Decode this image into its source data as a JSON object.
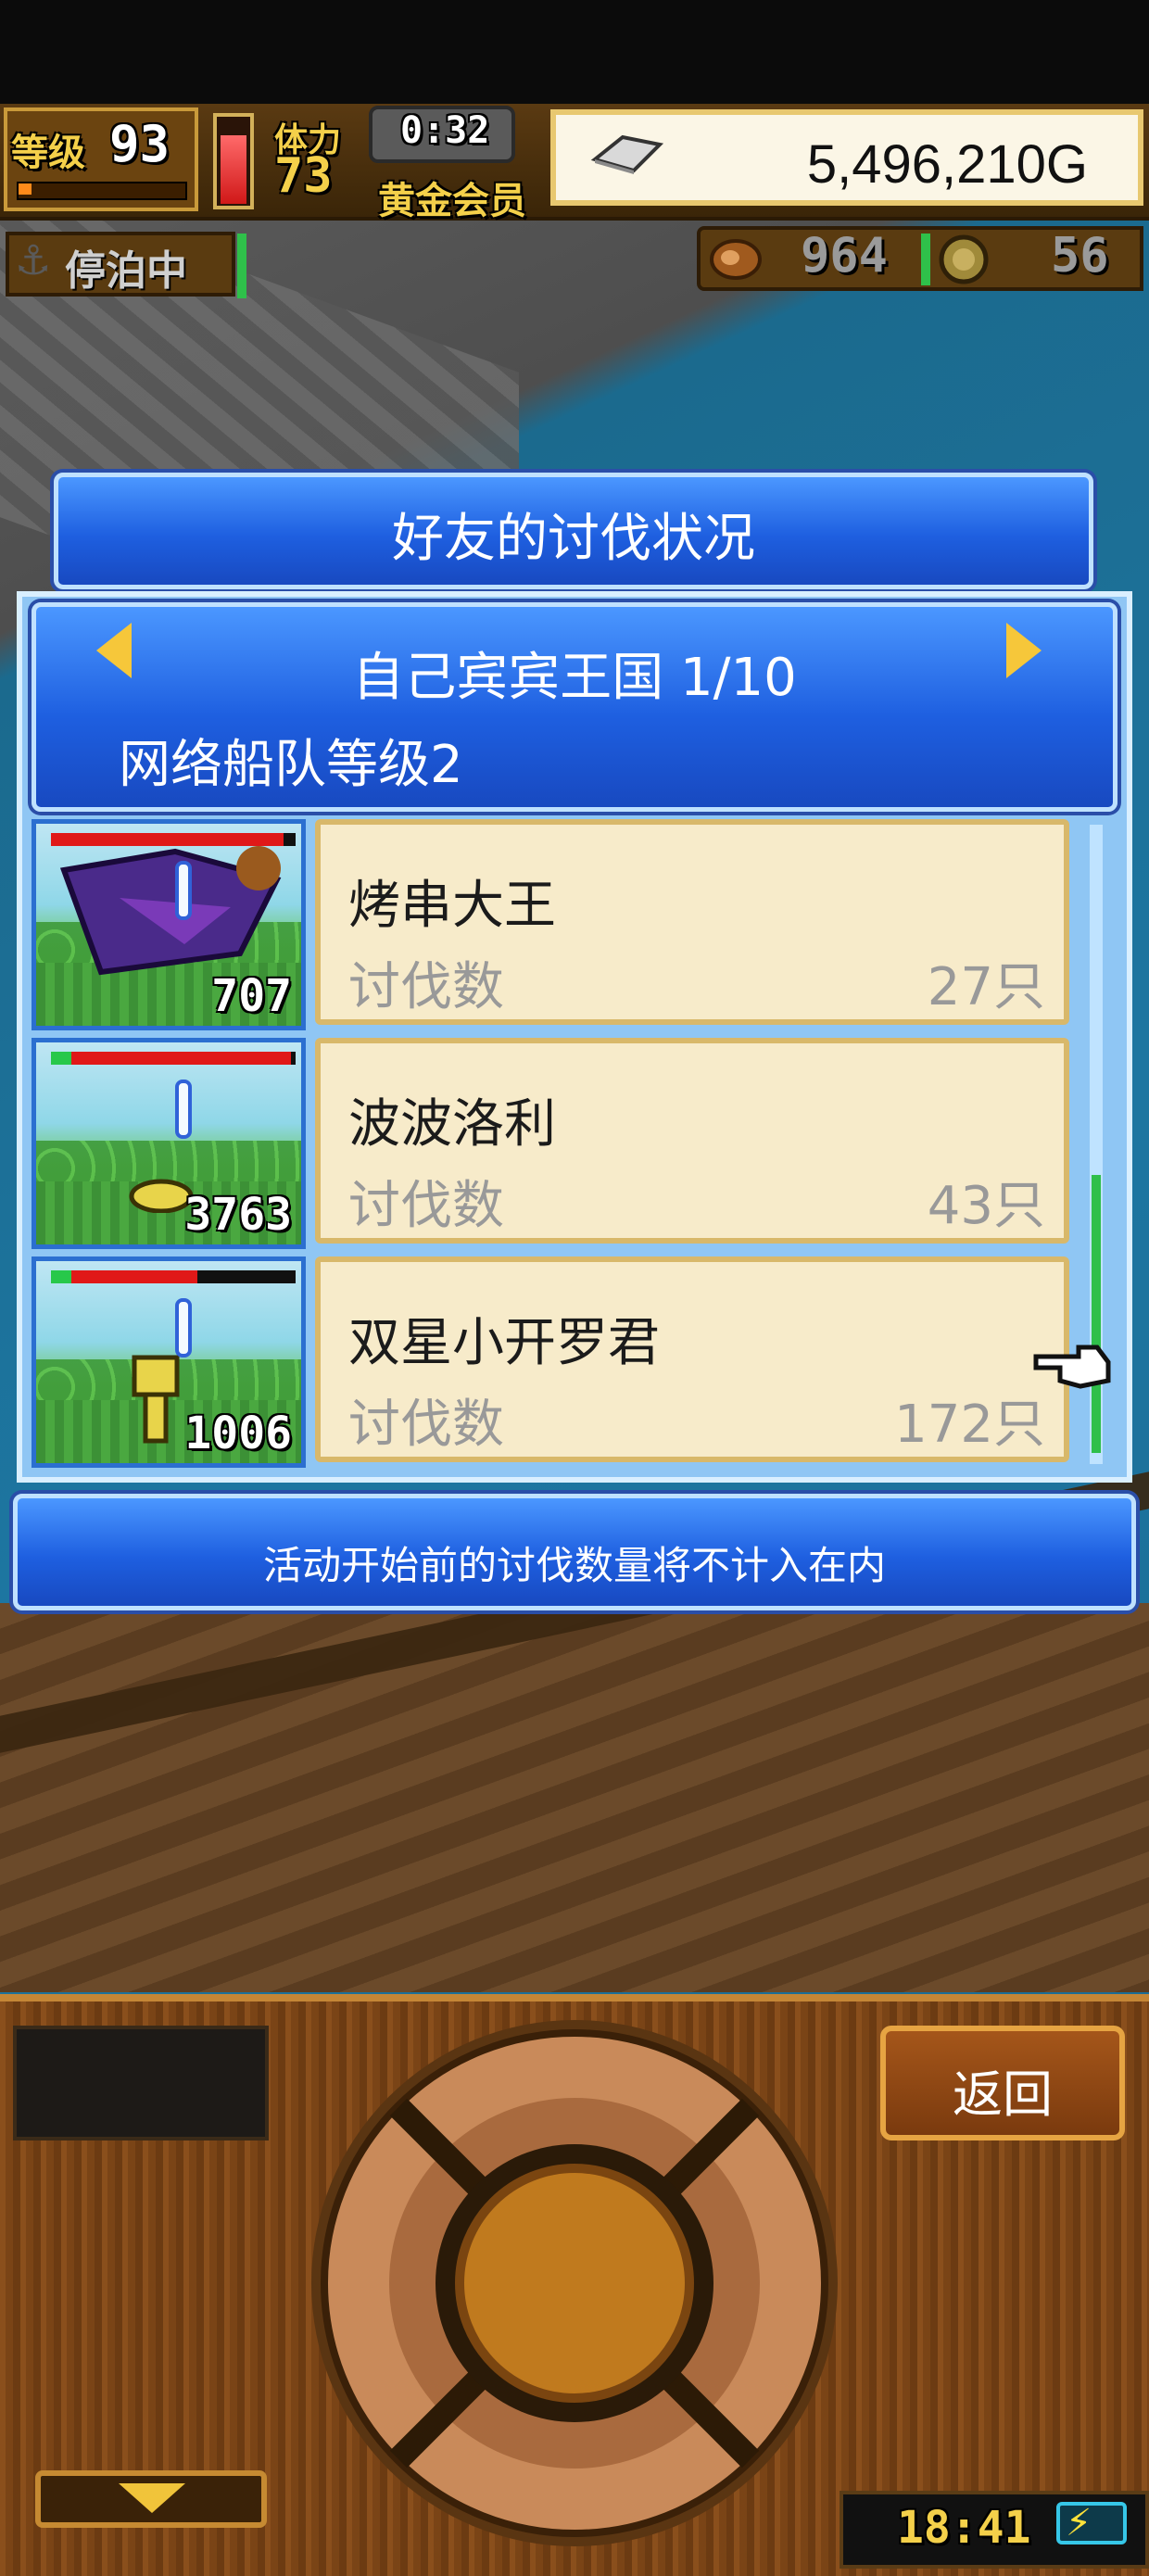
{
  "status_bar": {
    "level_label": "等级",
    "level": "93",
    "stamina_label": "体力",
    "stamina": "73",
    "timer": "0:32",
    "membership": "黄金会员",
    "money": "5,496,210G",
    "state": "停泊中",
    "resource1": "964",
    "resource2": "56"
  },
  "dialog": {
    "title": "好友的讨伐状况",
    "kingdom": "自己宾宾王国 1/10",
    "fleet_level": "网络船队等级2",
    "footer": "活动开始前的讨伐数量将不计入在内"
  },
  "friends": [
    {
      "name": "烤串大王",
      "label": "讨伐数",
      "value": "27只",
      "monster_count": "707",
      "hp_percent": 95
    },
    {
      "name": "波波洛利",
      "label": "讨伐数",
      "value": "43只",
      "monster_count": "3763",
      "hp_percent": 98
    },
    {
      "name": "双星小开罗君",
      "label": "讨伐数",
      "value": "172只",
      "monster_count": "1006",
      "hp_percent": 60
    }
  ],
  "controls": {
    "back": "返回",
    "clock": "18:41"
  },
  "colors": {
    "dialog_blue": "#1e5fe0",
    "card_bg": "#f7ebca",
    "hp_red": "#e01818",
    "scroll_green": "#2fbf4a"
  }
}
